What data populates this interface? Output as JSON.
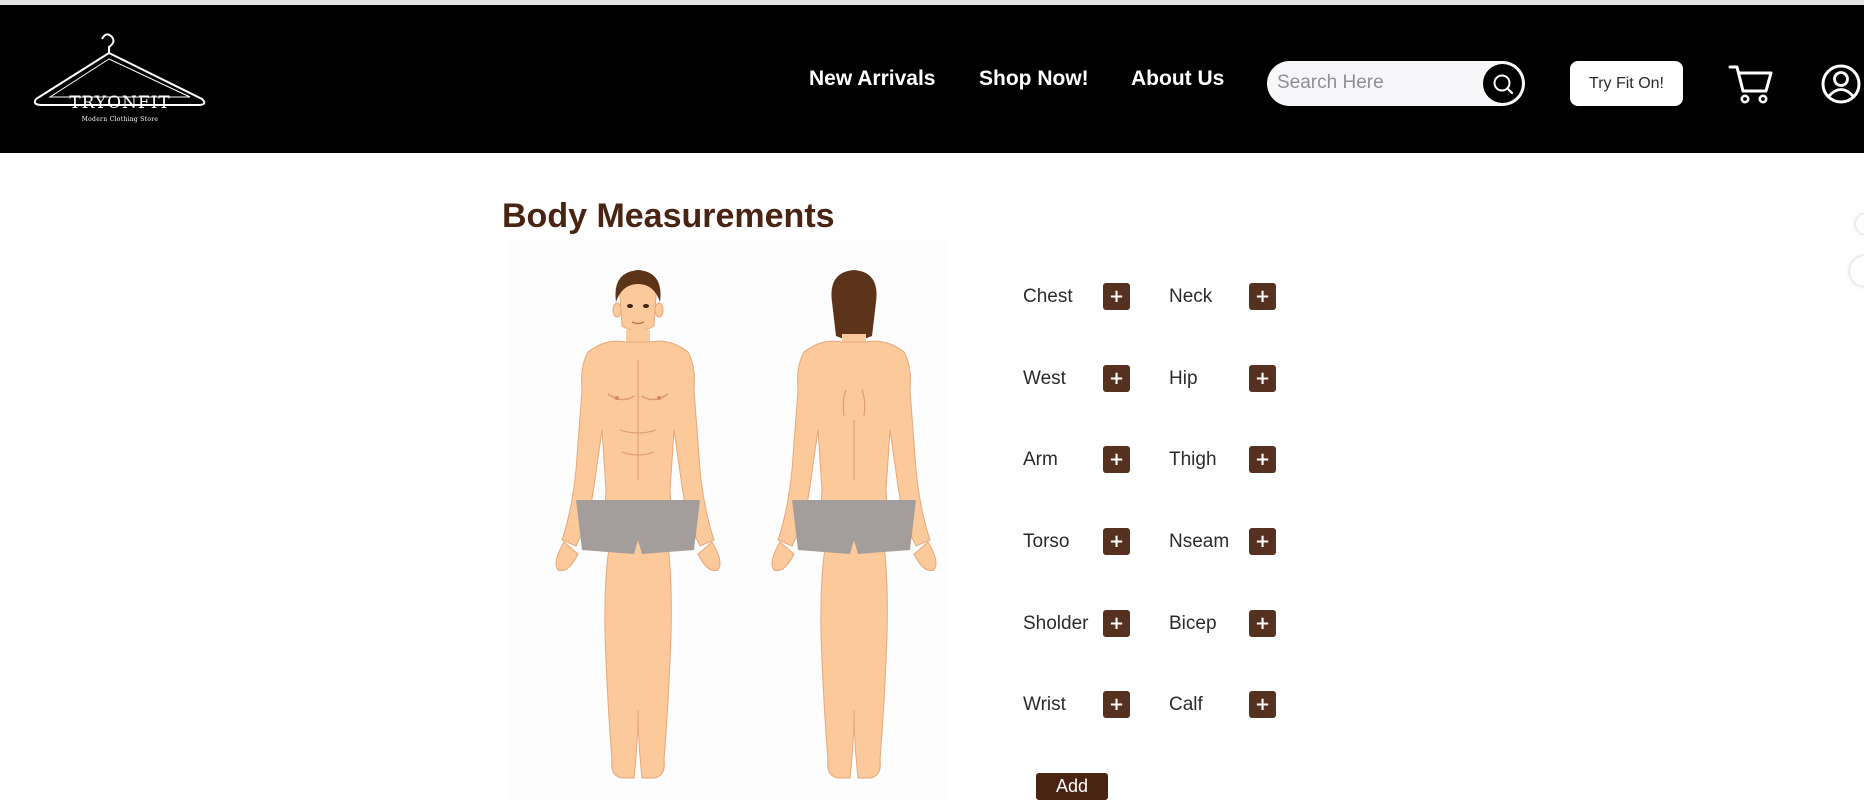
{
  "header": {
    "logo": {
      "brand": "TRYONFIT",
      "tagline": "Modern Clothing Store"
    },
    "nav": [
      {
        "label": "New Arrivals"
      },
      {
        "label": "Shop Now!"
      },
      {
        "label": "About Us"
      }
    ],
    "search": {
      "placeholder": "Search Here",
      "icon": "search-icon"
    },
    "try_fit_label": "Try Fit On!",
    "cart_icon": "cart-icon",
    "account_icon": "user-icon"
  },
  "main": {
    "title": "Body Measurements",
    "measurements": [
      {
        "label": "Chest"
      },
      {
        "label": "Neck"
      },
      {
        "label": "West"
      },
      {
        "label": "Hip"
      },
      {
        "label": "Arm"
      },
      {
        "label": "Thigh"
      },
      {
        "label": "Torso"
      },
      {
        "label": "Nseam"
      },
      {
        "label": "Sholder"
      },
      {
        "label": "Bicep"
      },
      {
        "label": "Wrist"
      },
      {
        "label": "Calf"
      }
    ],
    "plus_label": "+",
    "add_label": "Add"
  },
  "colors": {
    "header_bg": "#000000",
    "title": "#4a2412",
    "button": "#573120",
    "skin": "#fcc99a",
    "shorts": "#a39e9b",
    "hair": "#5b3419"
  }
}
